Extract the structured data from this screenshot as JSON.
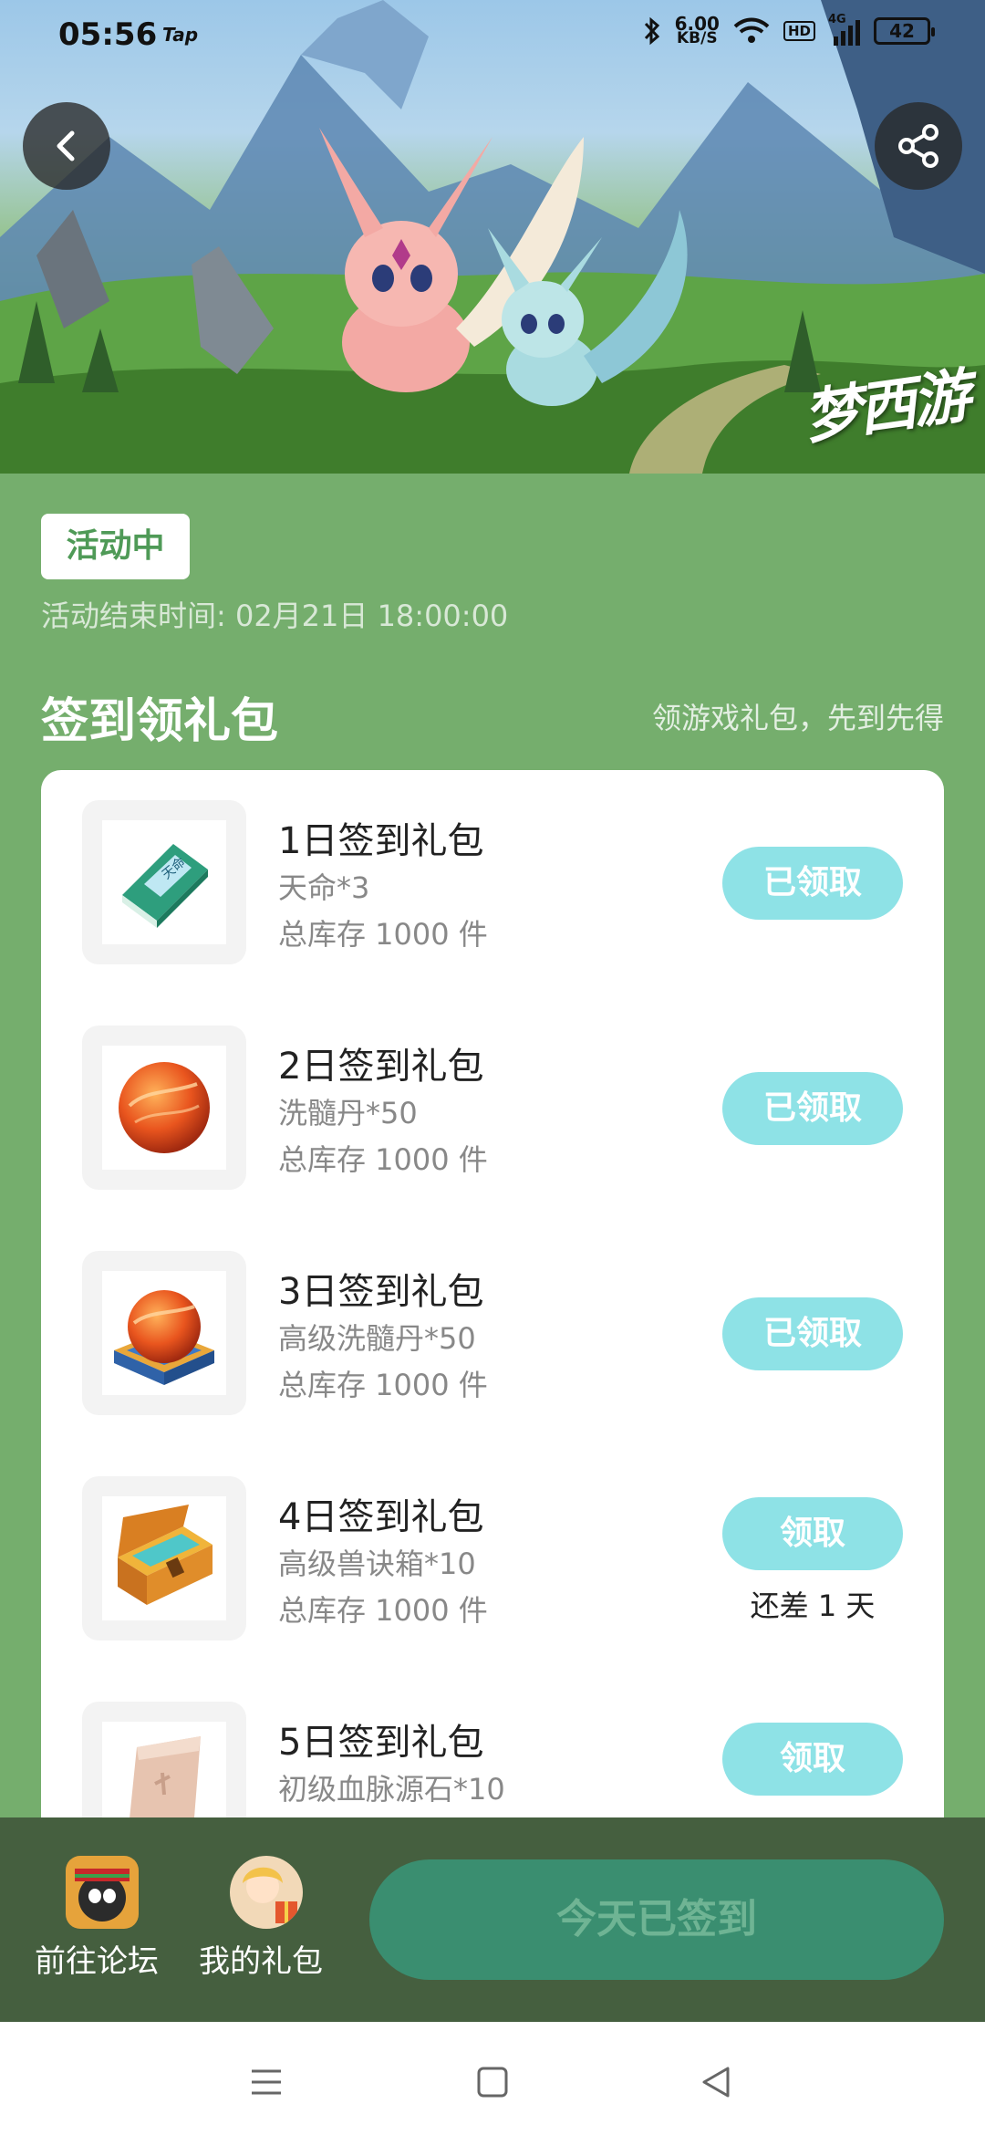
{
  "status_bar": {
    "time": "05:56",
    "app_tag": "Tap",
    "net_speed_value": "6.00",
    "net_speed_unit": "KB/S",
    "hd": "HD",
    "network": "4G",
    "battery": "42"
  },
  "hero": {
    "logo_text": "梦西游"
  },
  "activity": {
    "status_badge": "活动中",
    "end_time": "活动结束时间: 02月21日 18:00:00"
  },
  "section": {
    "title": "签到领礼包",
    "subtitle": "领游戏礼包，先到先得"
  },
  "gifts": [
    {
      "name": "1日签到礼包",
      "item": "天命*3",
      "stock": "总库存 1000 件",
      "button": "已领取",
      "icon": "book-icon"
    },
    {
      "name": "2日签到礼包",
      "item": "洗髓丹*50",
      "stock": "总库存 1000 件",
      "button": "已领取",
      "icon": "orb-icon"
    },
    {
      "name": "3日签到礼包",
      "item": "高级洗髓丹*50",
      "stock": "总库存 1000 件",
      "button": "已领取",
      "icon": "orb-box-icon"
    },
    {
      "name": "4日签到礼包",
      "item": "高级兽诀箱*10",
      "stock": "总库存 1000 件",
      "button": "领取",
      "remaining": "还差 1 天",
      "icon": "treasure-chest-icon"
    },
    {
      "name": "5日签到礼包",
      "item": "初级血脉源石*10",
      "button": "领取",
      "icon": "stone-tablet-icon"
    }
  ],
  "bottom_bar": {
    "forum_label": "前往论坛",
    "my_gifts_label": "我的礼包",
    "signed_button": "今天已签到"
  },
  "colors": {
    "page_background": "#75ae6d",
    "claim_button": "#8ee2e6",
    "bottom_bar": "#455f3f",
    "signed_button": "#3a8e70"
  }
}
